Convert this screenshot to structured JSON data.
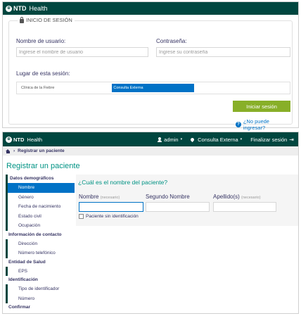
{
  "login": {
    "brand": {
      "mark": "⊕",
      "name": "NTD",
      "sub": "Health"
    },
    "legend": "INICIO DE SESIÓN",
    "username": {
      "label": "Nombre de usuario:",
      "placeholder": "Ingrese el nombre de usuario"
    },
    "password": {
      "label": "Contraseña:",
      "placeholder": "Ingrese su contraseña"
    },
    "location_label": "Lugar de esta sesión:",
    "locations": [
      "Clínica de la Fiebre",
      "Consulta Externa"
    ],
    "selected_location": "Consulta Externa",
    "submit_label": "Iniciar sesión",
    "forgot_label": "¿No puede ingresar?",
    "colors": {
      "header": "#00463f",
      "button": "#88af28",
      "link": "#0072c6"
    }
  },
  "app": {
    "brand": {
      "mark": "⊕",
      "name": "NTD",
      "sub": "Health"
    },
    "user": "admin",
    "location": "Consulta Externa",
    "logout_label": "Finalizar sesión",
    "breadcrumb": "Registrar un paciente",
    "title": "Registrar un paciente",
    "sidebar": {
      "sections": [
        {
          "title": "Datos demográficos",
          "items": [
            "Nombre",
            "Género",
            "Fecha de nacimiento",
            "Estado civil",
            "Ocupación"
          ]
        },
        {
          "title": "Información de contacto",
          "items": [
            "Dirección",
            "Número telefónico"
          ]
        },
        {
          "title": "Entidad de Salud",
          "items": [
            "EPS"
          ]
        },
        {
          "title": "Identificación",
          "items": [
            "Tipo de identificador",
            "Número"
          ]
        },
        {
          "title": "Confirmar",
          "items": []
        }
      ],
      "active": "Nombre"
    },
    "form": {
      "question": "¿Cuál es el nombre del paciente?",
      "first_name_label": "Nombre",
      "required_hint": "(necesario)",
      "middle_name_label": "Segundo Nombre",
      "last_name_label": "Apellido(s)",
      "unidentified_label": "Paciente sin identificación"
    }
  }
}
